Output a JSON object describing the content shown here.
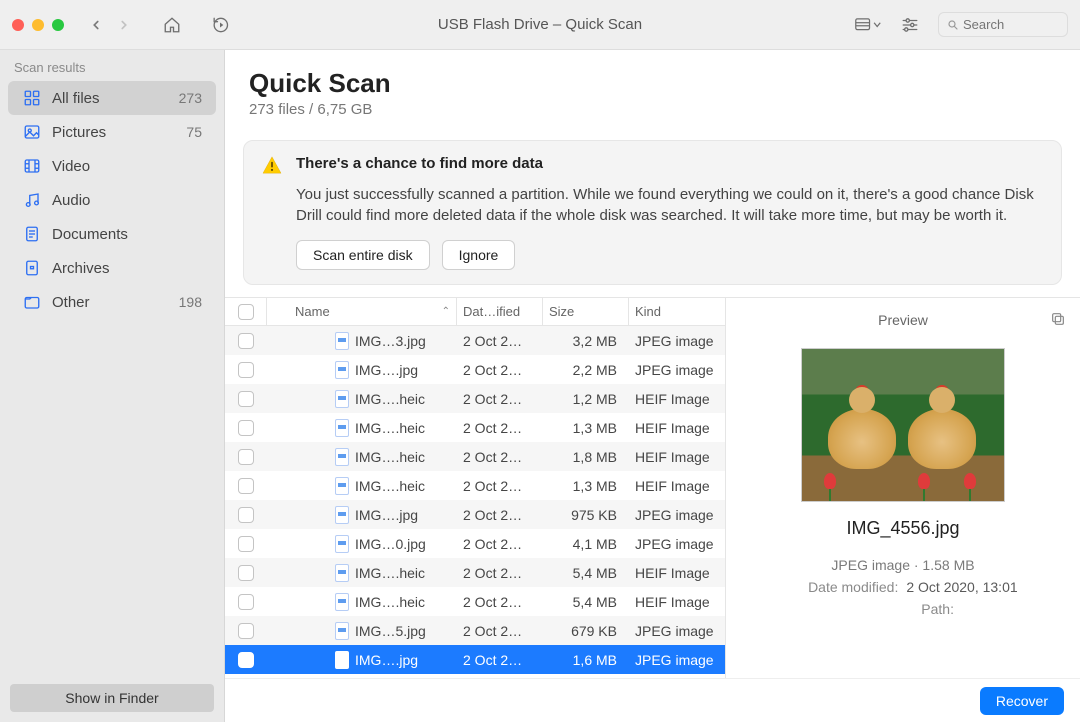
{
  "window_title": "USB Flash Drive – Quick Scan",
  "toolbar": {
    "search_placeholder": "Search"
  },
  "sidebar": {
    "heading": "Scan results",
    "items": [
      {
        "label": "All files",
        "count": "273",
        "icon": "grid"
      },
      {
        "label": "Pictures",
        "count": "75",
        "icon": "picture"
      },
      {
        "label": "Video",
        "count": "",
        "icon": "film"
      },
      {
        "label": "Audio",
        "count": "",
        "icon": "music"
      },
      {
        "label": "Documents",
        "count": "",
        "icon": "document"
      },
      {
        "label": "Archives",
        "count": "",
        "icon": "archive"
      },
      {
        "label": "Other",
        "count": "198",
        "icon": "folder"
      }
    ],
    "show_in_finder": "Show in Finder"
  },
  "main": {
    "title": "Quick Scan",
    "subtitle": "273 files / 6,75 GB"
  },
  "notice": {
    "title": "There's a chance to find more data",
    "text": "You just successfully scanned a partition. While we found everything we could on it, there's a good chance Disk Drill could find more deleted data if the whole disk was searched. It will take more time, but may be worth it.",
    "scan_button": "Scan entire disk",
    "ignore_button": "Ignore"
  },
  "table": {
    "headers": {
      "name": "Name",
      "date": "Dat…ified",
      "size": "Size",
      "kind": "Kind"
    },
    "rows": [
      {
        "name": "IMG…3.jpg",
        "date": "2 Oct 2…",
        "size": "3,2 MB",
        "kind": "JPEG image"
      },
      {
        "name": "IMG….jpg",
        "date": "2 Oct 2…",
        "size": "2,2 MB",
        "kind": "JPEG image"
      },
      {
        "name": "IMG….heic",
        "date": "2 Oct 2…",
        "size": "1,2 MB",
        "kind": "HEIF Image"
      },
      {
        "name": "IMG….heic",
        "date": "2 Oct 2…",
        "size": "1,3 MB",
        "kind": "HEIF Image"
      },
      {
        "name": "IMG….heic",
        "date": "2 Oct 2…",
        "size": "1,8 MB",
        "kind": "HEIF Image"
      },
      {
        "name": "IMG….heic",
        "date": "2 Oct 2…",
        "size": "1,3 MB",
        "kind": "HEIF Image"
      },
      {
        "name": "IMG….jpg",
        "date": "2 Oct 2…",
        "size": "975 KB",
        "kind": "JPEG image"
      },
      {
        "name": "IMG…0.jpg",
        "date": "2 Oct 2…",
        "size": "4,1 MB",
        "kind": "JPEG image"
      },
      {
        "name": "IMG….heic",
        "date": "2 Oct 2…",
        "size": "5,4 MB",
        "kind": "HEIF Image"
      },
      {
        "name": "IMG….heic",
        "date": "2 Oct 2…",
        "size": "5,4 MB",
        "kind": "HEIF Image"
      },
      {
        "name": "IMG…5.jpg",
        "date": "2 Oct 2…",
        "size": "679 KB",
        "kind": "JPEG image"
      },
      {
        "name": "IMG….jpg",
        "date": "2 Oct 2…",
        "size": "1,6 MB",
        "kind": "JPEG image"
      }
    ],
    "selected_index": 11
  },
  "preview": {
    "heading": "Preview",
    "filename": "IMG_4556.jpg",
    "kind_size": "JPEG image · 1.58 MB",
    "date_label": "Date modified:",
    "date_value": "2 Oct 2020, 13:01",
    "path_label": "Path:",
    "path_value": ""
  },
  "footer": {
    "recover": "Recover"
  }
}
